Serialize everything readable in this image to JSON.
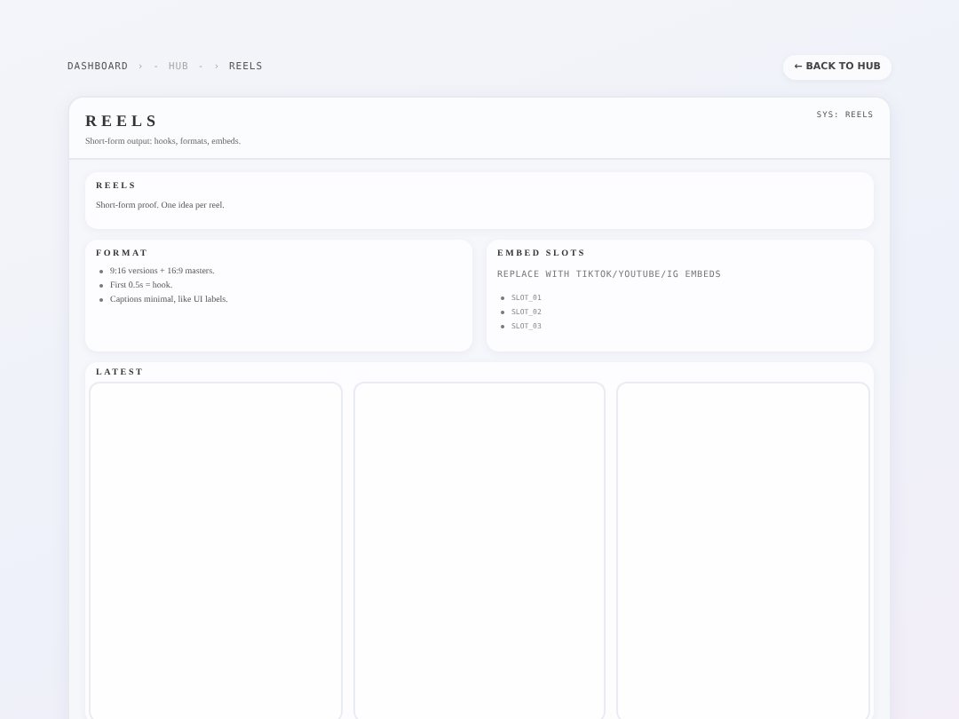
{
  "breadcrumb": [
    "DASHBOARD",
    "›",
    "-",
    "HUB",
    "-",
    "›",
    "REELS"
  ],
  "back_button": "← BACK TO HUB",
  "header": {
    "title": "REELS",
    "subtitle": "Short-form output: hooks, formats, embeds.",
    "sys": "SYS: REELS"
  },
  "intro": {
    "heading": "REELS",
    "text": "Short-form proof. One idea per reel."
  },
  "format": {
    "heading": "FORMAT",
    "items": [
      "9:16 versions + 16:9 masters.",
      "First 0.5s = hook.",
      "Captions minimal, like UI labels."
    ]
  },
  "embed_slots": {
    "heading": "EMBED SLOTS",
    "note": "REPLACE WITH TIKTOK/YOUTUBE/IG EMBEDS",
    "slots": [
      "SLOT_01",
      "SLOT_02",
      "SLOT_03"
    ]
  },
  "latest": {
    "heading": "LATEST",
    "tiles": [
      {
        "kind": "empty"
      },
      {
        "kind": "empty"
      },
      {
        "kind": "empty"
      }
    ]
  }
}
